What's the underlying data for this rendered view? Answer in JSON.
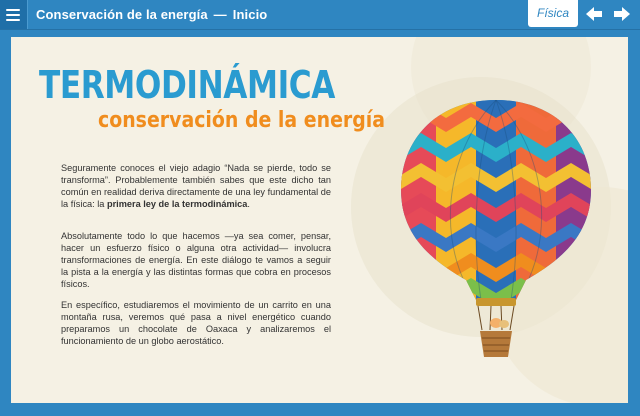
{
  "header": {
    "title": "Conservación de la energía",
    "separator": "—",
    "section": "Inicio",
    "subject": "Física",
    "icons": {
      "menu": "hamburger-menu-icon",
      "prev": "arrow-left-icon",
      "next": "arrow-right-icon"
    }
  },
  "colors": {
    "bar": "#2f86c1",
    "heading": "#2a9bd0",
    "subheading": "#f08d1e",
    "panel": "#f5f1e4"
  },
  "content": {
    "heading": "TERMODINÁMICA",
    "subheading": "conservación de la energía",
    "p1_a": "Seguramente conoces el viejo adagio “Nada se pierde, todo se transforma”. Probablemente también sabes que este dicho tan común en realidad deriva directamente de una ley fundamental de la física: la ",
    "p1_bold": "primera ley de la termodinámica",
    "p1_end": ".",
    "p2": "Absolutamente todo lo que hacemos —ya sea comer, pensar, hacer un esfuerzo físico o alguna otra actividad— involucra transformaciones de energía. En este diálogo te vamos a seguir la pista a la energía y las distintas formas que cobra en procesos físicos.",
    "p3": "En específico, estudiaremos el movimiento de un carrito en una montaña rusa, veremos qué pasa a nivel energético cuando preparamos un chocolate de Oaxaca y analizaremos el funcionamiento de un globo aerostático.",
    "illustration": "hot-air-balloon"
  }
}
